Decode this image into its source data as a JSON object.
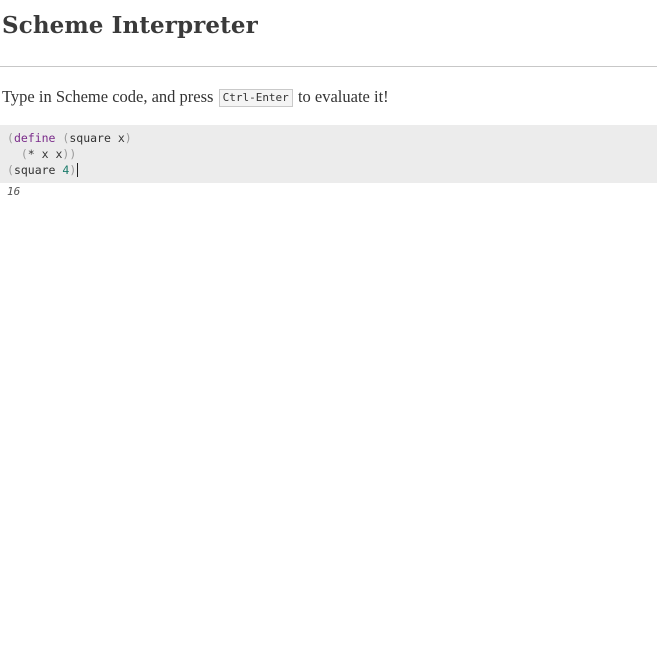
{
  "header": {
    "title": "Scheme Interpreter"
  },
  "instructions": {
    "before": "Type in Scheme code, and press ",
    "shortcut": "Ctrl-Enter",
    "after": " to evaluate it!"
  },
  "editor": {
    "lines": [
      [
        {
          "t": "(",
          "c": "paren"
        },
        {
          "t": "define",
          "c": "kw"
        },
        {
          "t": " ",
          "c": "sym"
        },
        {
          "t": "(",
          "c": "paren"
        },
        {
          "t": "square x",
          "c": "sym"
        },
        {
          "t": ")",
          "c": "paren"
        }
      ],
      [
        {
          "t": "  ",
          "c": "sym"
        },
        {
          "t": "(",
          "c": "paren"
        },
        {
          "t": "* x x",
          "c": "sym"
        },
        {
          "t": "))",
          "c": "paren"
        }
      ],
      [
        {
          "t": "(",
          "c": "paren"
        },
        {
          "t": "square ",
          "c": "sym"
        },
        {
          "t": "4",
          "c": "num"
        },
        {
          "t": ")",
          "c": "paren"
        }
      ]
    ]
  },
  "result": {
    "value": "16"
  },
  "colors": {
    "paren": "#9a9a9a",
    "keyword": "#7a2b8a",
    "number": "#1a7a6a",
    "editor_background": "#ececec"
  }
}
